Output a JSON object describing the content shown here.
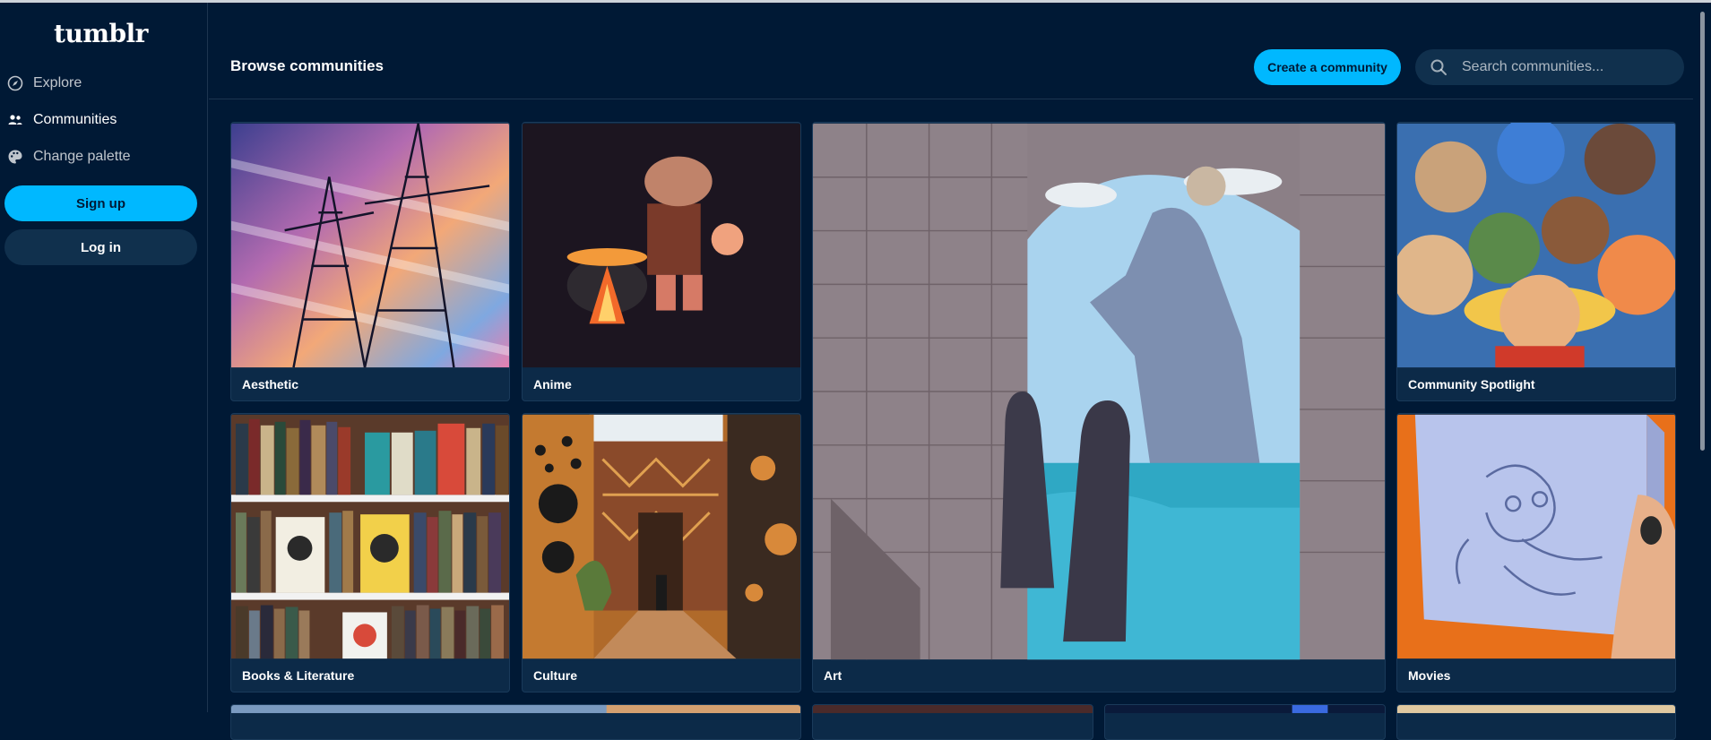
{
  "brand": {
    "logo_text": "tumblr"
  },
  "sidebar": {
    "items": [
      {
        "label": "Explore",
        "icon": "compass-icon",
        "active": false
      },
      {
        "label": "Communities",
        "icon": "people-icon",
        "active": true
      },
      {
        "label": "Change palette",
        "icon": "palette-icon",
        "active": false
      }
    ],
    "signup_label": "Sign up",
    "login_label": "Log in"
  },
  "header": {
    "title": "Browse communities",
    "create_label": "Create a community",
    "search_placeholder": "Search communities..."
  },
  "communities": [
    {
      "label": "Aesthetic"
    },
    {
      "label": "Anime"
    },
    {
      "label": "Art"
    },
    {
      "label": "Community Spotlight"
    },
    {
      "label": "Books & Literature"
    },
    {
      "label": "Culture"
    },
    {
      "label": "Movies"
    }
  ],
  "colors": {
    "background": "#001935",
    "accent": "#00b8ff",
    "surface": "#10304d"
  }
}
